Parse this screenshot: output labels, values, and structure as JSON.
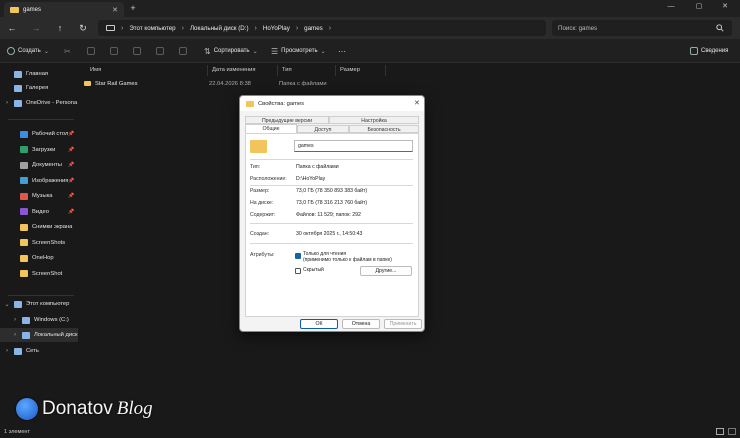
{
  "window": {
    "tab_title": "games",
    "tab_close": "✕",
    "new_tab": "+",
    "minimize": "—",
    "maximize": "▢",
    "close": "✕"
  },
  "nav": {
    "back": "←",
    "forward": "→",
    "up": "↑",
    "refresh": "↻"
  },
  "address": {
    "segments": [
      "Этот компьютер",
      "Локальный диск (D:)",
      "HoYoPlay",
      "games"
    ]
  },
  "search": {
    "placeholder": "Поиск: games"
  },
  "commandbar": {
    "create": "Создать",
    "sort": "Сортировать",
    "view": "Просмотреть",
    "more": "···",
    "details": "Сведения"
  },
  "sidebar": {
    "top": [
      {
        "label": "Главная",
        "icon": "home-icon"
      },
      {
        "label": "Галерея",
        "icon": "gallery-icon"
      },
      {
        "label": "OneDrive - Persona",
        "icon": "cloud-icon"
      }
    ],
    "pinned": [
      {
        "label": "Рабочий стол",
        "icon": "desktop-icon",
        "color": "#3c8de0"
      },
      {
        "label": "Загрузки",
        "icon": "download-icon",
        "color": "#2f9e6a"
      },
      {
        "label": "Документы",
        "icon": "document-icon",
        "color": "#a0a0a0"
      },
      {
        "label": "Изображения",
        "icon": "pictures-icon",
        "color": "#3fa0d8"
      },
      {
        "label": "Музыка",
        "icon": "music-icon",
        "color": "#e0584a"
      },
      {
        "label": "Видео",
        "icon": "video-icon",
        "color": "#8a55d0"
      },
      {
        "label": "Снимки экрана",
        "icon": "folder-icon",
        "color": "#f2c55c"
      },
      {
        "label": "ScreenShots",
        "icon": "folder-icon",
        "color": "#f2c55c"
      },
      {
        "label": "OneHop",
        "icon": "folder-icon",
        "color": "#f2c55c"
      },
      {
        "label": "ScreenShot",
        "icon": "folder-icon",
        "color": "#f2c55c"
      }
    ],
    "computer": [
      {
        "label": "Этот компьютер",
        "icon": "computer-icon"
      },
      {
        "label": "Windows (C:)",
        "icon": "drive-icon"
      },
      {
        "label": "Локальный диск",
        "icon": "drive-icon"
      },
      {
        "label": "Сеть",
        "icon": "network-icon"
      }
    ]
  },
  "columns": [
    "Имя",
    "Дата изменения",
    "Тип",
    "Размер"
  ],
  "files": [
    {
      "name": "Star Rail Games",
      "date": "22.04.2026 8:38",
      "type": "Папка с файлами",
      "size": ""
    }
  ],
  "status": {
    "count": "1 элемент"
  },
  "watermark": {
    "brand": "Donatov",
    "suffix": "Blog"
  },
  "dialog": {
    "title": "Свойства: games",
    "close": "✕",
    "tabs_row1": [
      "Предыдущие версии",
      "Настройка"
    ],
    "tabs_row2": [
      "Общие",
      "Доступ",
      "Безопасность"
    ],
    "name": "games",
    "props": [
      {
        "label": "Тип:",
        "value": "Папка с файлами"
      },
      {
        "label": "Расположение:",
        "value": "D:\\HoYoPlay"
      },
      {
        "label": "Размер:",
        "value": "73,0 ГБ (78 350 893 383 байт)"
      },
      {
        "label": "На диске:",
        "value": "73,0 ГБ (78 316 213 760 байт)"
      },
      {
        "label": "Содержит:",
        "value": "Файлов: 11 529; папок: 292"
      },
      {
        "label": "Создан:",
        "value": "30 октября 2025 г., 14:50:43"
      }
    ],
    "attributes_label": "Атрибуты:",
    "readonly_label": "Только для чтения",
    "readonly_note": "(применимо только к файлам в папке)",
    "hidden_label": "Скрытый",
    "other_button": "Другие...",
    "ok": "ОК",
    "cancel": "Отмена",
    "apply": "Применить"
  }
}
